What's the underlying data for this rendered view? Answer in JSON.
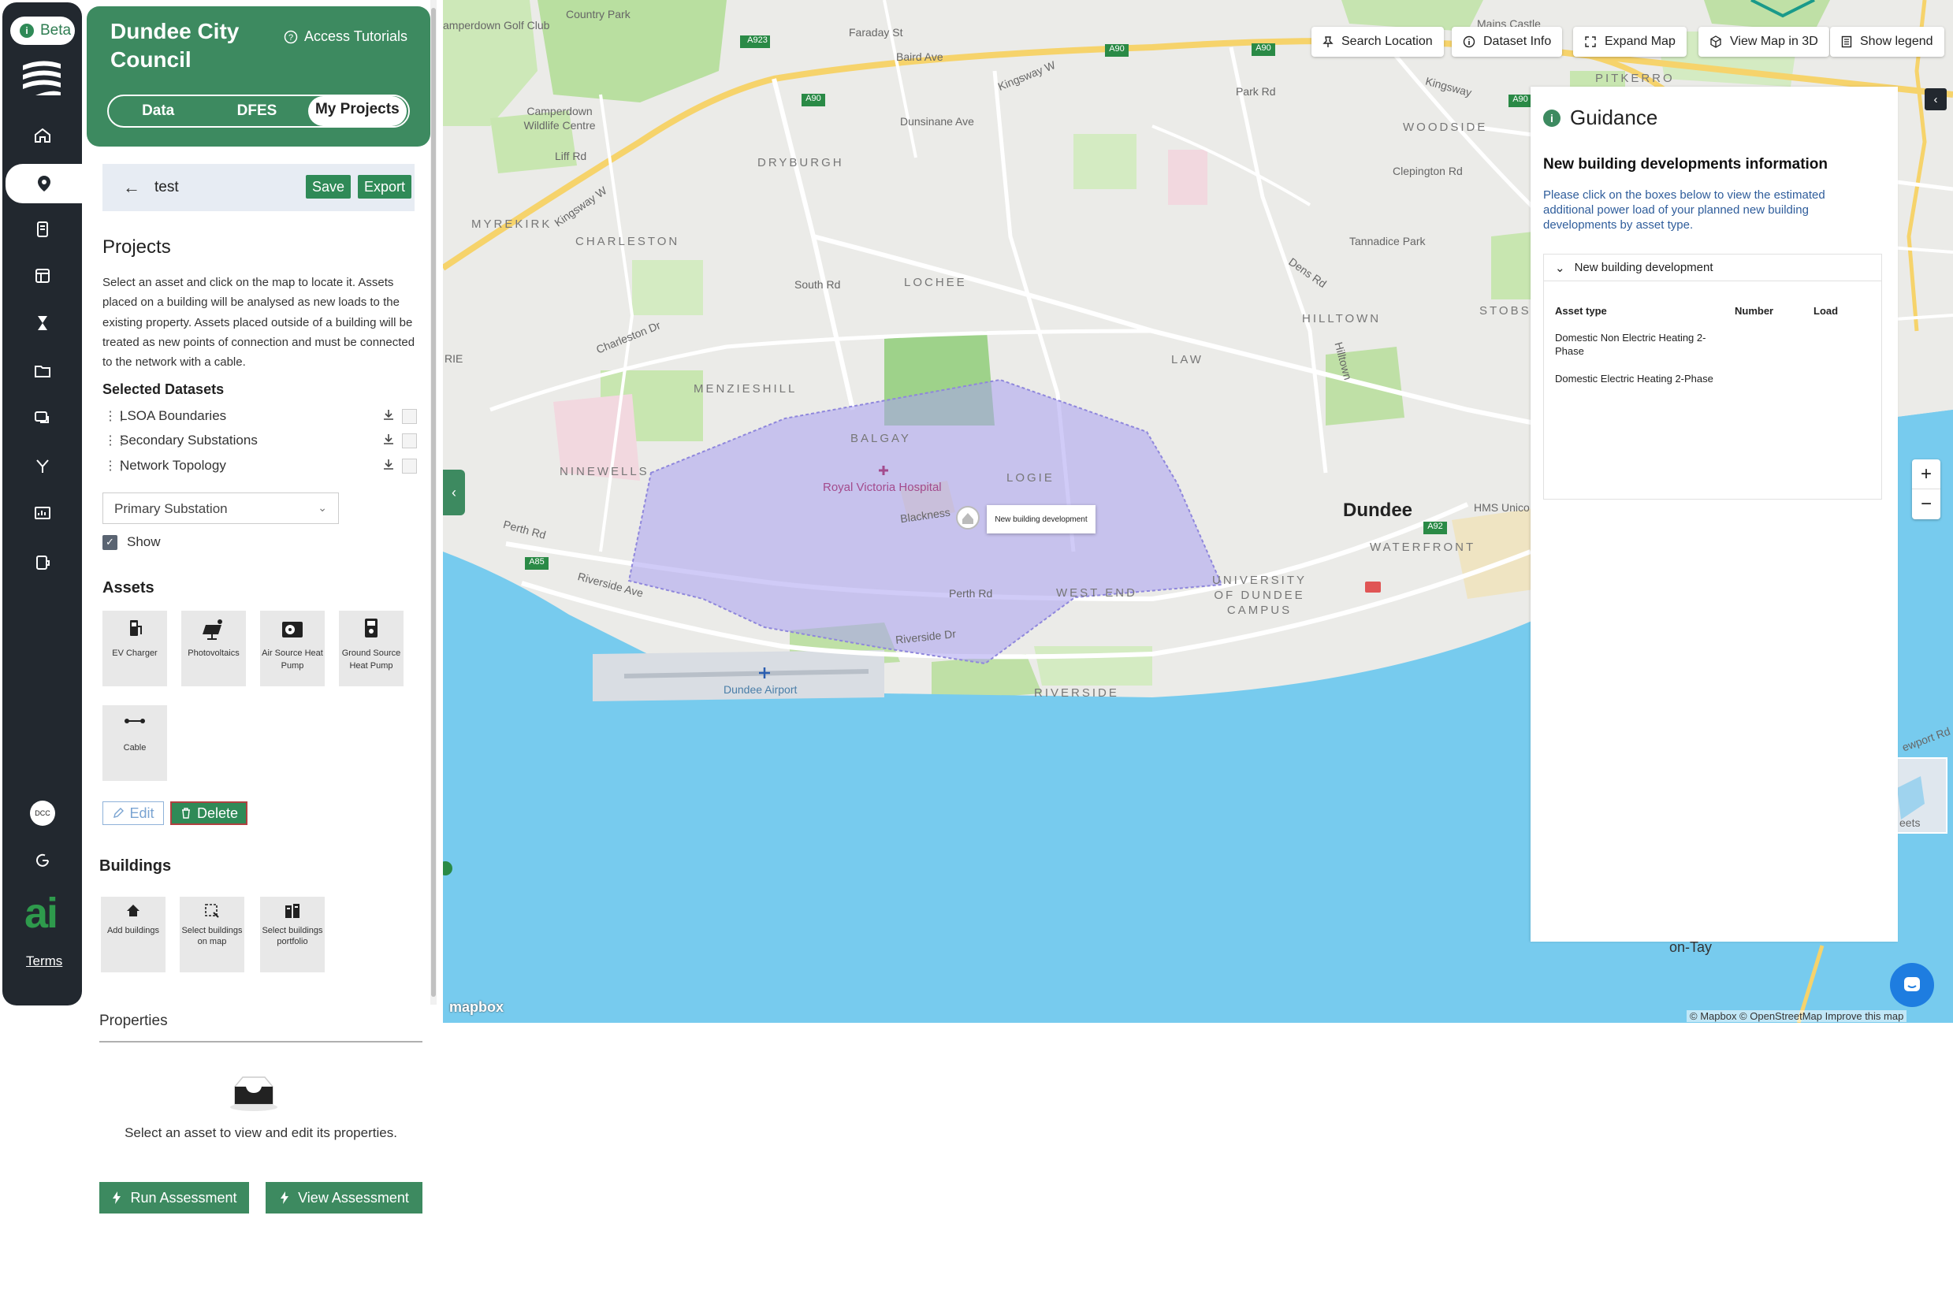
{
  "rail": {
    "beta_label": "Beta",
    "avatar": "DCC",
    "ai_logo": "ai",
    "terms": "Terms",
    "icons": [
      "home-icon",
      "map-pin-icon",
      "report-icon",
      "layout-icon",
      "hourglass-icon",
      "folder-icon",
      "chat-icon",
      "network-icon",
      "dashboard-icon",
      "tool-icon",
      "settings-icon",
      "refresh-icon"
    ]
  },
  "header": {
    "org_name": "Dundee City Council",
    "tutorials": "Access Tutorials",
    "tabs": [
      "Data",
      "DFES",
      "My Projects"
    ],
    "active_tab": "My Projects"
  },
  "project": {
    "name": "test",
    "save": "Save",
    "export": "Export"
  },
  "projects": {
    "title": "Projects",
    "description": "Select an asset and click on the map to locate it. Assets placed on a building will be analysed as new loads to the existing property. Assets placed outside of a building will be treated as new points of connection and must be connected to the network with a cable.",
    "selected_datasets_title": "Selected Datasets",
    "datasets": [
      "LSOA Boundaries",
      "Secondary Substations",
      "Network Topology"
    ],
    "substation_select": "Primary Substation",
    "show_label": "Show"
  },
  "assets": {
    "title": "Assets",
    "items": [
      "EV Charger",
      "Photovoltaics",
      "Air Source Heat Pump",
      "Ground Source Heat Pump",
      "Cable"
    ],
    "edit": "Edit",
    "delete": "Delete"
  },
  "buildings": {
    "title": "Buildings",
    "items": [
      "Add buildings",
      "Select buildings on map",
      "Select buildings portfolio"
    ]
  },
  "properties": {
    "title": "Properties",
    "empty": "Select an asset to view and edit its properties.",
    "run": "Run Assessment",
    "view": "View Assessment"
  },
  "map": {
    "toolbar": [
      "Search Location",
      "Dataset Info",
      "Expand Map",
      "View Map in 3D",
      "Show legend"
    ],
    "callout": "New building development",
    "labels": {
      "country_park": "Country Park",
      "golf": "amperdown Golf Club",
      "faraday": "Faraday St",
      "baird": "Baird Ave",
      "mains": "Mains Castle",
      "camperdown": "Camperdown Wildlife Centre",
      "dunsinane": "Dunsinane Ave",
      "kingsway_w": "Kingsway W",
      "park_rd": "Park Rd",
      "kingsway": "Kingsway",
      "pitkerro": "PITKERRO",
      "woodside": "WOODSIDE",
      "liff": "Liff Rd",
      "dryburgh": "DRYBURGH",
      "clepington": "Clepington Rd",
      "myrekirk": "MYREKIRK",
      "charleston": "CHARLESTON",
      "tannadice": "Tannadice Park",
      "dens": "Dens Rd",
      "south_rd": "South Rd",
      "lochee": "LOCHEE",
      "stobswell": "STOBSWEL",
      "charleston_dr": "Charleston Dr",
      "hilltown": "HILLTOWN",
      "hilltown_rd": "Hilltown",
      "law": "LAW",
      "menzieshill": "MENZIESHILL",
      "balgay": "BALGAY",
      "ninewells": "NINEWELLS",
      "hospital": "Royal Victoria Hospital",
      "logie": "LOGIE",
      "blackness": "Blackness",
      "dundee": "Dundee",
      "hms": "HMS Unico",
      "waterfront": "WATERFRONT",
      "perth_rd_w": "Perth Rd",
      "riverside_ave": "Riverside Ave",
      "perth_rd": "Perth Rd",
      "west_end": "WEST END",
      "university": "UNIVERSITY OF DUNDEE CAMPUS",
      "riverside_dr": "Riverside Dr",
      "airport": "Dundee Airport",
      "riverside": "RIVERSIDE",
      "newport": "ewport Rd",
      "tay": "on-Tay",
      "streets": "eets",
      "rie": "RIE",
      "a923": "A923",
      "a90_1": "A90",
      "a90_2": "A90",
      "a90_3": "A90",
      "a90_4": "A90",
      "a85": "A85",
      "a92": "A92"
    },
    "mapbox": "mapbox",
    "attribution": "© Mapbox © OpenStreetMap  Improve this map"
  },
  "guidance": {
    "title": "Guidance",
    "subtitle": "New building developments information",
    "description": "Please click on the boxes below to view the estimated additional power load of your planned new building developments by asset type.",
    "accordion_title": "New building development",
    "columns": [
      "Asset type",
      "Number",
      "Load"
    ],
    "rows": [
      {
        "type": "Domestic Non Electric Heating 2-Phase",
        "number": "",
        "load": ""
      },
      {
        "type": "Domestic Electric Heating 2-Phase",
        "number": "",
        "load": ""
      }
    ]
  }
}
